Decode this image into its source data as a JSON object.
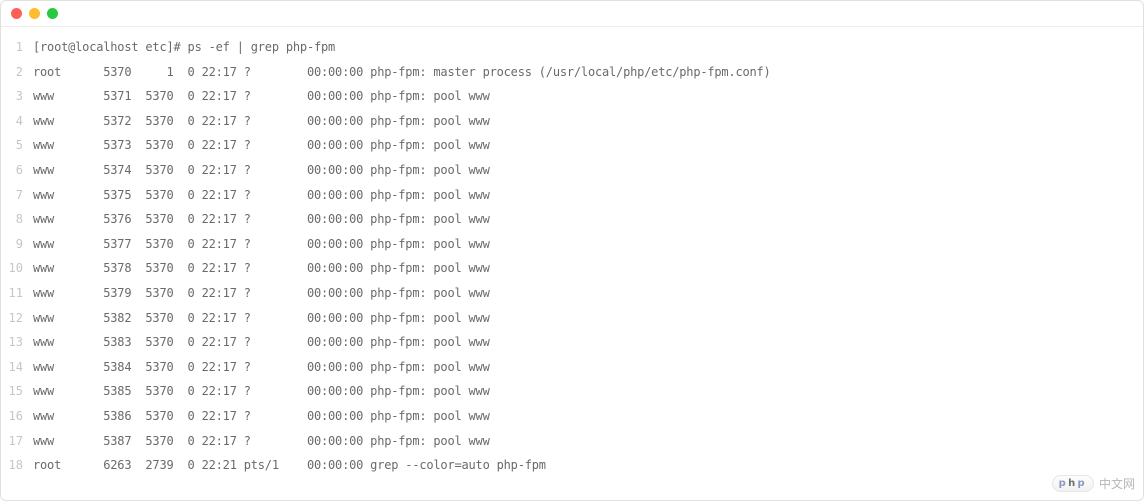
{
  "titlebar": {
    "dots": [
      "#ff5f57",
      "#febc2e",
      "#28c840"
    ]
  },
  "terminal": {
    "lines": [
      "[root@localhost etc]# ps -ef | grep php-fpm",
      "root      5370     1  0 22:17 ?        00:00:00 php-fpm: master process (/usr/local/php/etc/php-fpm.conf)",
      "www       5371  5370  0 22:17 ?        00:00:00 php-fpm: pool www",
      "www       5372  5370  0 22:17 ?        00:00:00 php-fpm: pool www",
      "www       5373  5370  0 22:17 ?        00:00:00 php-fpm: pool www",
      "www       5374  5370  0 22:17 ?        00:00:00 php-fpm: pool www",
      "www       5375  5370  0 22:17 ?        00:00:00 php-fpm: pool www",
      "www       5376  5370  0 22:17 ?        00:00:00 php-fpm: pool www",
      "www       5377  5370  0 22:17 ?        00:00:00 php-fpm: pool www",
      "www       5378  5370  0 22:17 ?        00:00:00 php-fpm: pool www",
      "www       5379  5370  0 22:17 ?        00:00:00 php-fpm: pool www",
      "www       5382  5370  0 22:17 ?        00:00:00 php-fpm: pool www",
      "www       5383  5370  0 22:17 ?        00:00:00 php-fpm: pool www",
      "www       5384  5370  0 22:17 ?        00:00:00 php-fpm: pool www",
      "www       5385  5370  0 22:17 ?        00:00:00 php-fpm: pool www",
      "www       5386  5370  0 22:17 ?        00:00:00 php-fpm: pool www",
      "www       5387  5370  0 22:17 ?        00:00:00 php-fpm: pool www",
      "root      6263  2739  0 22:21 pts/1    00:00:00 grep --color=auto php-fpm"
    ]
  },
  "watermark": {
    "pill_p": "p",
    "pill_h": "h",
    "pill_p2": "p",
    "text": "中文网"
  }
}
